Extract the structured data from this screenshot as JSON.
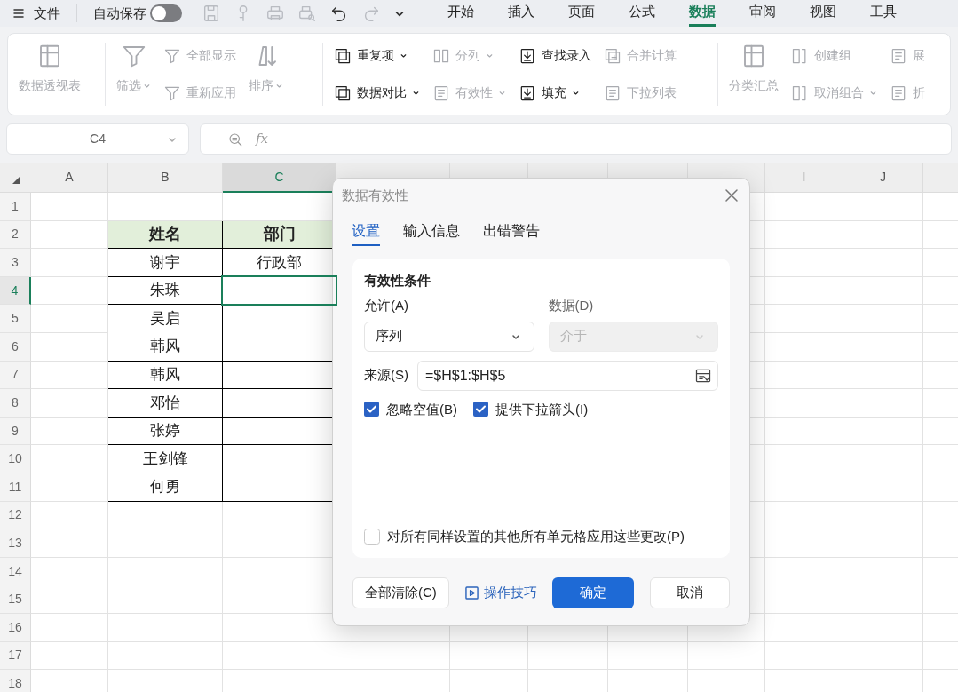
{
  "title_bar": {
    "file_menu": "文件",
    "autosave": {
      "label": "自动保存",
      "on": false
    },
    "quick_access": [
      {
        "disabled": true
      },
      {
        "disabled": true
      },
      {
        "disabled": true
      },
      {
        "disabled": true
      },
      {
        "disabled": false
      },
      {
        "disabled": true
      }
    ],
    "tabs": [
      {
        "label": "开始",
        "selected": false
      },
      {
        "label": "插入",
        "selected": false
      },
      {
        "label": "页面",
        "selected": false
      },
      {
        "label": "公式",
        "selected": false
      },
      {
        "label": "数据",
        "selected": true
      },
      {
        "label": "审阅",
        "selected": false
      },
      {
        "label": "视图",
        "selected": false
      },
      {
        "label": "工具",
        "selected": false
      }
    ]
  },
  "ribbon": {
    "groups": [
      {
        "columns": [
          {
            "kind": "large",
            "items": [
              {
                "label": "数据透视表",
                "disabled": true,
                "dropdown": false
              }
            ]
          }
        ]
      },
      {
        "columns": [
          {
            "kind": "large",
            "items": [
              {
                "label": "筛选",
                "disabled": true,
                "dropdown": true
              }
            ]
          },
          {
            "kind": "small",
            "items": [
              {
                "label": "全部显示",
                "disabled": true,
                "dropdown": false
              },
              {
                "label": "重新应用",
                "disabled": true,
                "dropdown": false
              }
            ]
          },
          {
            "kind": "large",
            "items": [
              {
                "label": "排序",
                "disabled": true,
                "dropdown": true
              }
            ]
          }
        ]
      },
      {
        "columns": [
          {
            "kind": "small",
            "items": [
              {
                "label": "重复项",
                "disabled": false,
                "dropdown": true
              },
              {
                "label": "数据对比",
                "disabled": false,
                "dropdown": true
              }
            ]
          },
          {
            "kind": "small",
            "items": [
              {
                "label": "分列",
                "disabled": true,
                "dropdown": true
              },
              {
                "label": "有效性",
                "disabled": true,
                "dropdown": true
              }
            ]
          },
          {
            "kind": "small",
            "items": [
              {
                "label": "查找录入",
                "disabled": false,
                "dropdown": false
              },
              {
                "label": "填充",
                "disabled": false,
                "dropdown": true
              }
            ]
          },
          {
            "kind": "small",
            "items": [
              {
                "label": "合并计算",
                "disabled": true,
                "dropdown": false
              },
              {
                "label": "下拉列表",
                "disabled": true,
                "dropdown": false
              }
            ]
          }
        ]
      },
      {
        "columns": [
          {
            "kind": "large",
            "items": [
              {
                "label": "分类汇总",
                "disabled": true,
                "dropdown": false
              }
            ]
          },
          {
            "kind": "small",
            "items": [
              {
                "label": "创建组",
                "disabled": true,
                "dropdown": false
              },
              {
                "label": "取消组合",
                "disabled": true,
                "dropdown": true
              }
            ]
          },
          {
            "kind": "small",
            "items": [
              {
                "label": "展",
                "disabled": true,
                "dropdown": false
              },
              {
                "label": "折",
                "disabled": true,
                "dropdown": false
              }
            ]
          }
        ]
      }
    ]
  },
  "formula_bar": {
    "name_box": "C4",
    "fx": "fx"
  },
  "sheet": {
    "columns": [
      {
        "label": "A",
        "selected": false
      },
      {
        "label": "B",
        "selected": false
      },
      {
        "label": "C",
        "selected": true
      },
      {
        "selected": false
      },
      {
        "selected": false
      },
      {
        "selected": false
      },
      {
        "selected": false
      },
      {
        "selected": false
      },
      {
        "label": "I",
        "selected": false
      },
      {
        "label": "J",
        "selected": false
      }
    ],
    "rows": [
      {
        "label": "1",
        "selected": false
      },
      {
        "label": "2",
        "selected": false
      },
      {
        "label": "3",
        "selected": false
      },
      {
        "label": "4",
        "selected": true
      },
      {
        "label": "5",
        "selected": false
      },
      {
        "label": "6",
        "selected": false
      },
      {
        "label": "7",
        "selected": false
      },
      {
        "label": "8",
        "selected": false
      },
      {
        "label": "9",
        "selected": false
      },
      {
        "label": "10",
        "selected": false
      },
      {
        "label": "11",
        "selected": false
      },
      {
        "label": "12",
        "selected": false
      },
      {
        "label": "13",
        "selected": false
      },
      {
        "label": "14",
        "selected": false
      },
      {
        "label": "15",
        "selected": false
      },
      {
        "label": "16",
        "selected": false
      },
      {
        "label": "17",
        "selected": false
      },
      {
        "label": "18",
        "selected": false
      }
    ],
    "table": {
      "headers": [
        "姓名",
        "部门"
      ],
      "rows": [
        {
          "name": [
            "谢宇"
          ],
          "department": "行政部",
          "selected": false
        },
        {
          "name": [
            "朱珠"
          ],
          "selected": true
        },
        {
          "name": [
            "吴启",
            "韩风"
          ],
          "selected": false
        },
        {
          "name": [
            "韩风"
          ],
          "selected": false
        },
        {
          "name": [
            "邓怡"
          ],
          "selected": false
        },
        {
          "name": [
            "张婷"
          ],
          "selected": false
        },
        {
          "name": [
            "王剑锋"
          ],
          "selected": false
        },
        {
          "name": [
            "何勇"
          ],
          "selected": false
        }
      ]
    }
  },
  "dialog": {
    "title": "数据有效性",
    "tabs": [
      {
        "label": "设置",
        "selected": true
      },
      {
        "label": "输入信息",
        "selected": false
      },
      {
        "label": "出错警告",
        "selected": false
      }
    ],
    "section_title": "有效性条件",
    "allow": {
      "label": "允许(A)",
      "value": "序列",
      "disabled": false
    },
    "data": {
      "label": "数据(D)",
      "value": "介于",
      "disabled": true
    },
    "source": {
      "label": "来源(S)",
      "value": "=$H$1:$H$5"
    },
    "options": [
      {
        "label": "忽略空值(B)",
        "checked": true
      },
      {
        "label": "提供下拉箭头(I)",
        "checked": true
      }
    ],
    "apply_all": {
      "label": "对所有同样设置的其他所有单元格应用这些更改(P)",
      "checked": false
    },
    "buttons": [
      {
        "label": "全部清除(C)",
        "kind": "secondary"
      },
      {
        "label": "操作技巧",
        "kind": "link"
      },
      {
        "label": "确定",
        "kind": "primary"
      },
      {
        "label": "取消",
        "kind": "secondary"
      }
    ]
  }
}
